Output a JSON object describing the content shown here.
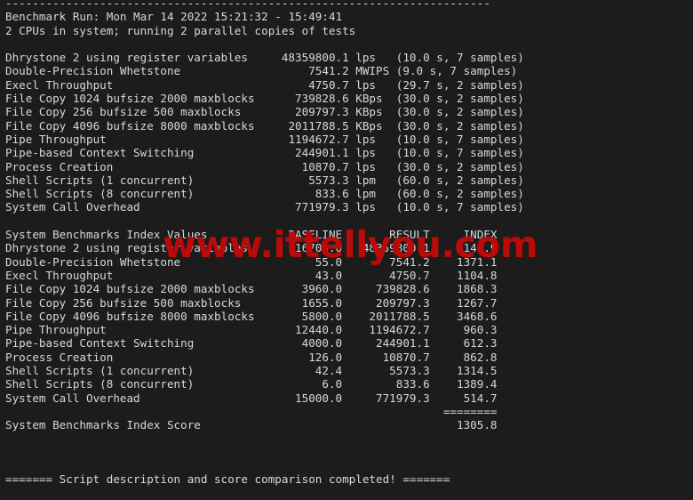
{
  "terminal": {
    "background_color": "#1c1c1c",
    "foreground_color": "#d8d8d8",
    "separator_top": "------------------------------------------------------------------------",
    "header": {
      "benchmark_run": "Benchmark Run: Mon Mar 14 2022 15:21:32 - 15:49:41",
      "cpu_line": "2 CPUs in system; running 2 parallel copies of tests"
    },
    "raw_results": {
      "rows": [
        {
          "name": "Dhrystone 2 using register variables",
          "value": "48359800.1",
          "unit": "lps",
          "detail": "(10.0 s, 7 samples)"
        },
        {
          "name": "Double-Precision Whetstone",
          "value": "7541.2",
          "unit": "MWIPS",
          "detail": "(9.0 s, 7 samples)"
        },
        {
          "name": "Execl Throughput",
          "value": "4750.7",
          "unit": "lps",
          "detail": "(29.7 s, 2 samples)"
        },
        {
          "name": "File Copy 1024 bufsize 2000 maxblocks",
          "value": "739828.6",
          "unit": "KBps",
          "detail": "(30.0 s, 2 samples)"
        },
        {
          "name": "File Copy 256 bufsize 500 maxblocks",
          "value": "209797.3",
          "unit": "KBps",
          "detail": "(30.0 s, 2 samples)"
        },
        {
          "name": "File Copy 4096 bufsize 8000 maxblocks",
          "value": "2011788.5",
          "unit": "KBps",
          "detail": "(30.0 s, 2 samples)"
        },
        {
          "name": "Pipe Throughput",
          "value": "1194672.7",
          "unit": "lps",
          "detail": "(10.0 s, 7 samples)"
        },
        {
          "name": "Pipe-based Context Switching",
          "value": "244901.1",
          "unit": "lps",
          "detail": "(10.0 s, 7 samples)"
        },
        {
          "name": "Process Creation",
          "value": "10870.7",
          "unit": "lps",
          "detail": "(30.0 s, 2 samples)"
        },
        {
          "name": "Shell Scripts (1 concurrent)",
          "value": "5573.3",
          "unit": "lpm",
          "detail": "(60.0 s, 2 samples)"
        },
        {
          "name": "Shell Scripts (8 concurrent)",
          "value": "833.6",
          "unit": "lpm",
          "detail": "(60.0 s, 2 samples)"
        },
        {
          "name": "System Call Overhead",
          "value": "771979.3",
          "unit": "lps",
          "detail": "(10.0 s, 7 samples)"
        }
      ]
    },
    "index_table": {
      "title": "System Benchmarks Index Values",
      "columns": [
        "BASELINE",
        "RESULT",
        "INDEX"
      ],
      "rows": [
        {
          "name": "Dhrystone 2 using register variables",
          "baseline": "116700.0",
          "result": "48359800.1",
          "index": "4143.9"
        },
        {
          "name": "Double-Precision Whetstone",
          "baseline": "55.0",
          "result": "7541.2",
          "index": "1371.1"
        },
        {
          "name": "Execl Throughput",
          "baseline": "43.0",
          "result": "4750.7",
          "index": "1104.8"
        },
        {
          "name": "File Copy 1024 bufsize 2000 maxblocks",
          "baseline": "3960.0",
          "result": "739828.6",
          "index": "1868.3"
        },
        {
          "name": "File Copy 256 bufsize 500 maxblocks",
          "baseline": "1655.0",
          "result": "209797.3",
          "index": "1267.7"
        },
        {
          "name": "File Copy 4096 bufsize 8000 maxblocks",
          "baseline": "5800.0",
          "result": "2011788.5",
          "index": "3468.6"
        },
        {
          "name": "Pipe Throughput",
          "baseline": "12440.0",
          "result": "1194672.7",
          "index": "960.3"
        },
        {
          "name": "Pipe-based Context Switching",
          "baseline": "4000.0",
          "result": "244901.1",
          "index": "612.3"
        },
        {
          "name": "Process Creation",
          "baseline": "126.0",
          "result": "10870.7",
          "index": "862.8"
        },
        {
          "name": "Shell Scripts (1 concurrent)",
          "baseline": "42.4",
          "result": "5573.3",
          "index": "1314.5"
        },
        {
          "name": "Shell Scripts (8 concurrent)",
          "baseline": "6.0",
          "result": "833.6",
          "index": "1389.4"
        },
        {
          "name": "System Call Overhead",
          "baseline": "15000.0",
          "result": "771979.3",
          "index": "514.7"
        }
      ],
      "score_separator": "========",
      "score_label": "System Benchmarks Index Score",
      "score_value": "1305.8"
    },
    "footer": "======= Script description and score comparison completed! ======="
  },
  "watermark": {
    "text": "www.ittellyou.com",
    "color": "#bb0a0a"
  }
}
